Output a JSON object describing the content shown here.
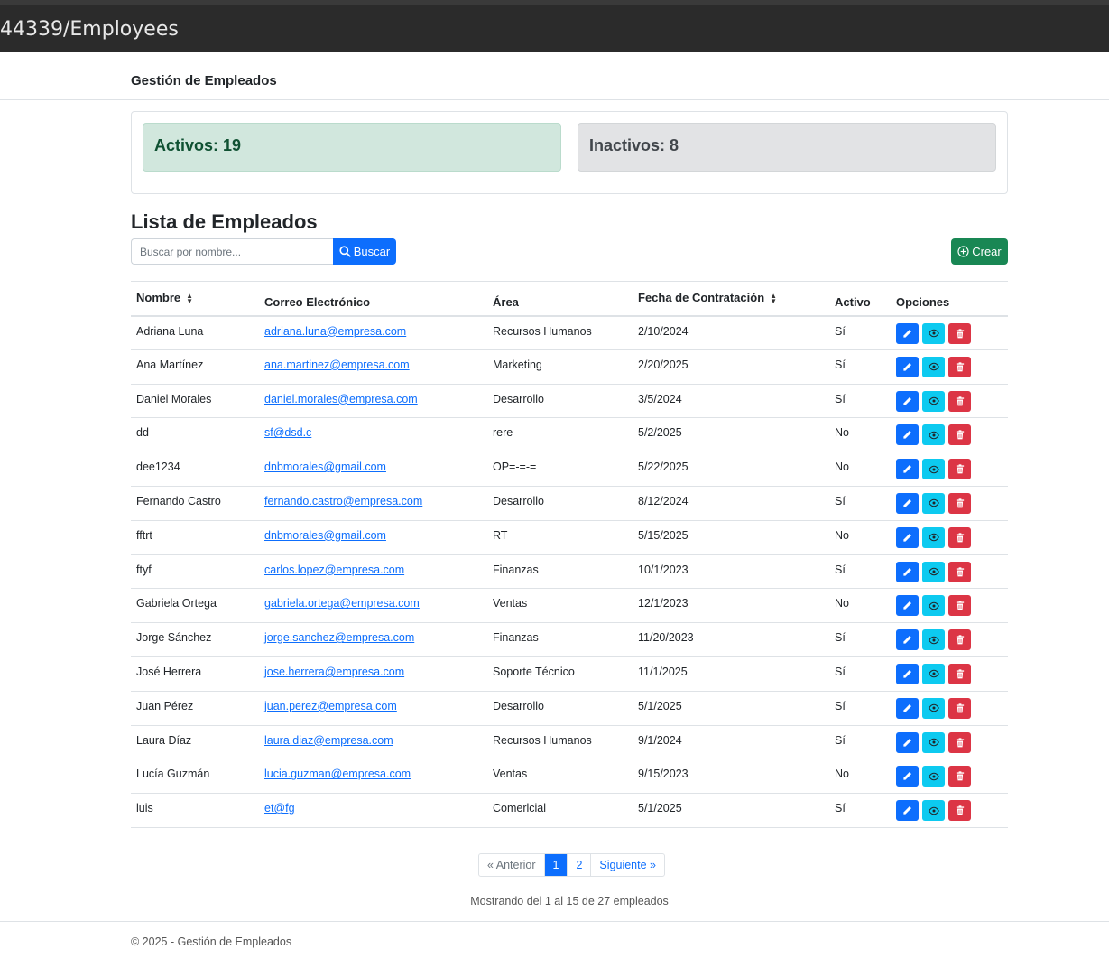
{
  "browser": {
    "url_fragment": "44339/Employees"
  },
  "navbar": {
    "brand": "Gestión de Empleados"
  },
  "stats": {
    "active": "Activos: 19",
    "inactive": "Inactivos: 8"
  },
  "list": {
    "title": "Lista de Empleados",
    "search_placeholder": "Buscar por nombre...",
    "search_label": "Buscar",
    "create_label": "Crear"
  },
  "table": {
    "headers": [
      "Nombre",
      "Correo Electrónico",
      "Área",
      "Fecha de Contratación",
      "Activo",
      "Opciones"
    ],
    "rows": [
      [
        "Adriana Luna",
        "adriana.luna@empresa.com",
        "Recursos Humanos",
        "2/10/2024",
        "Sí"
      ],
      [
        "Ana Martínez",
        "ana.martinez@empresa.com",
        "Marketing",
        "2/20/2025",
        "Sí"
      ],
      [
        "Daniel Morales",
        "daniel.morales@empresa.com",
        "Desarrollo",
        "3/5/2024",
        "Sí"
      ],
      [
        "dd",
        "sf@dsd.c",
        "rere",
        "5/2/2025",
        "No"
      ],
      [
        "dee1234",
        "dnbmorales@gmail.com",
        "OP=-=-=",
        "5/22/2025",
        "No"
      ],
      [
        "Fernando Castro",
        "fernando.castro@empresa.com",
        "Desarrollo",
        "8/12/2024",
        "Sí"
      ],
      [
        "fftrt",
        "dnbmorales@gmail.com",
        "RT",
        "5/15/2025",
        "No"
      ],
      [
        "ftyf",
        "carlos.lopez@empresa.com",
        "Finanzas",
        "10/1/2023",
        "Sí"
      ],
      [
        "Gabriela Ortega",
        "gabriela.ortega@empresa.com",
        "Ventas",
        "12/1/2023",
        "No"
      ],
      [
        "Jorge Sánchez",
        "jorge.sanchez@empresa.com",
        "Finanzas",
        "11/20/2023",
        "Sí"
      ],
      [
        "José Herrera",
        "jose.herrera@empresa.com",
        "Soporte Técnico",
        "11/1/2025",
        "Sí"
      ],
      [
        "Juan Pérez",
        "juan.perez@empresa.com",
        "Desarrollo",
        "5/1/2025",
        "Sí"
      ],
      [
        "Laura Díaz",
        "laura.diaz@empresa.com",
        "Recursos Humanos",
        "9/1/2024",
        "Sí"
      ],
      [
        "Lucía Guzmán",
        "lucia.guzman@empresa.com",
        "Ventas",
        "9/15/2023",
        "No"
      ],
      [
        "luis",
        "et@fg",
        "Comerlcial",
        "5/1/2025",
        "Sí"
      ]
    ]
  },
  "pagination": {
    "prev": "« Anterior",
    "pages": [
      "1",
      "2"
    ],
    "current": "1",
    "next": "Siguiente »"
  },
  "showing": "Mostrando del 1 al 15 de 27 empleados",
  "footer": "© 2025 - Gestión de Empleados",
  "icons": {
    "search": "search-icon",
    "create": "plus-circle-icon",
    "edit": "pencil-icon",
    "view": "eye-icon",
    "delete": "trash-icon",
    "sort": "sort-icon"
  },
  "colors": {
    "primary": "#0d6efd",
    "info": "#0dcaf0",
    "danger": "#dc3545",
    "success": "#198754",
    "active_bg": "#d1e7dd",
    "inactive_bg": "#e2e3e5"
  }
}
